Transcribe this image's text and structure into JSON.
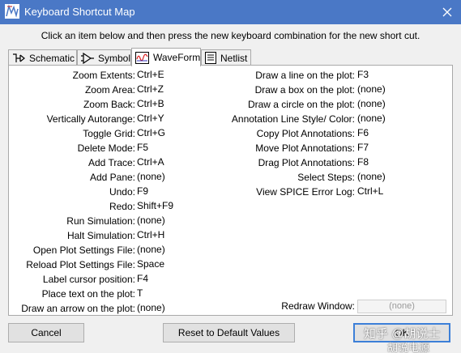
{
  "window": {
    "title": "Keyboard Shortcut Map",
    "instruction": "Click an item below and then press the new keyboard combination for the new short cut."
  },
  "tabs": [
    {
      "label": "Schematic",
      "icon": "schematic-icon",
      "active": false
    },
    {
      "label": "Symbol",
      "icon": "symbol-icon",
      "active": false
    },
    {
      "label": "WaveForm",
      "icon": "waveform-icon",
      "active": true
    },
    {
      "label": "Netlist",
      "icon": "netlist-icon",
      "active": false
    }
  ],
  "left_column": [
    {
      "label": "Zoom Extents:",
      "value": "Ctrl+E"
    },
    {
      "label": "Zoom Area:",
      "value": "Ctrl+Z"
    },
    {
      "label": "Zoom Back:",
      "value": "Ctrl+B"
    },
    {
      "label": "Vertically Autorange:",
      "value": "Ctrl+Y"
    },
    {
      "label": "Toggle Grid:",
      "value": "Ctrl+G"
    },
    {
      "label": "Delete Mode:",
      "value": "F5"
    },
    {
      "label": "Add Trace:",
      "value": "Ctrl+A"
    },
    {
      "label": "Add Pane:",
      "value": "(none)"
    },
    {
      "label": "Undo:",
      "value": "F9"
    },
    {
      "label": "Redo:",
      "value": "Shift+F9"
    },
    {
      "label": "Run Simulation:",
      "value": "(none)"
    },
    {
      "label": "Halt Simulation:",
      "value": "Ctrl+H"
    },
    {
      "label": "Open Plot Settings File:",
      "value": "(none)"
    },
    {
      "label": "Reload Plot Settings File:",
      "value": "Space"
    },
    {
      "label": "Label cursor position:",
      "value": "F4"
    },
    {
      "label": "Place text on the plot:",
      "value": "T"
    },
    {
      "label": "Draw an arrow on the plot:",
      "value": "(none)"
    }
  ],
  "right_column": [
    {
      "label": "Draw a line on the plot:",
      "value": "F3"
    },
    {
      "label": "Draw a box on the plot:",
      "value": "(none)"
    },
    {
      "label": "Draw a circle on the plot:",
      "value": "(none)"
    },
    {
      "label": "Annotation Line Style/ Color:",
      "value": "(none)"
    },
    {
      "label": "Copy Plot Annotations:",
      "value": "F6"
    },
    {
      "label": "Move Plot Annotations:",
      "value": "F7"
    },
    {
      "label": "Drag Plot Annotations:",
      "value": "F8"
    },
    {
      "label": "Select Steps:",
      "value": "(none)"
    },
    {
      "label": "View SPICE Error Log:",
      "value": "Ctrl+L"
    }
  ],
  "redraw": {
    "label": "Redraw Window:",
    "value": "(none)"
  },
  "buttons": {
    "cancel": "Cancel",
    "reset": "Reset to Default Values",
    "ok": "OK"
  },
  "watermark": {
    "line1": "知乎 @胡说士",
    "line2": "胡说电源"
  },
  "colors": {
    "titlebar": "#4a78c6",
    "panel": "#ffffff",
    "field_bg": "#f4f4f4",
    "field_text": "#9a9a9a",
    "default_button_border": "#3c7fd8"
  }
}
